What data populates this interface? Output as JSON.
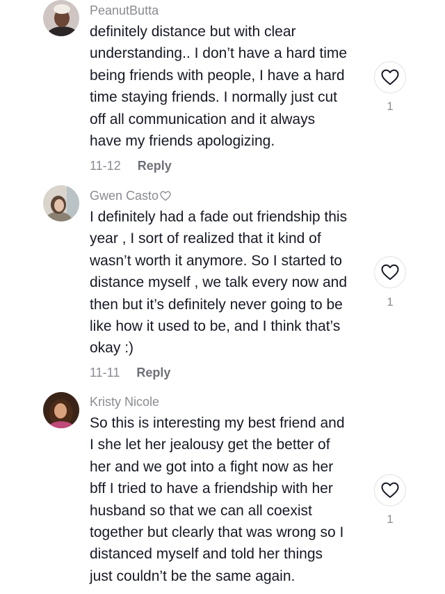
{
  "comments": [
    {
      "username": "PeanutButta",
      "has_heart_badge": false,
      "lines": [
        "definitely distance but with clear",
        "understanding.. I don’t have a hard time",
        "being friends with people, I have a hard",
        "time staying friends. I normally just cut",
        "off all communication and it always",
        "have my friends apologizing."
      ],
      "date": "11-12",
      "reply_label": "Reply",
      "like_count": "1",
      "avatar_colors": {
        "bg": "#cfc6c4",
        "skin": "#6b4636",
        "hair": "#f1ece6",
        "shirt": "#2b2526"
      }
    },
    {
      "username": "Gwen Casto",
      "has_heart_badge": true,
      "lines": [
        "I definitely had a fade out friendship this",
        "year , I sort of realized that it kind of",
        "wasn’t worth it anymore. So I started to",
        "distance myself , we talk every now and",
        "then but it’s definitely never going to be",
        "like how it used to be, and I think that’s",
        "okay :)"
      ],
      "date": "11-11",
      "reply_label": "Reply",
      "like_count": "1",
      "avatar_colors": {
        "bg": "#d9d4cc",
        "skin": "#e2c2ab",
        "hair": "#5b4434",
        "shirt": "#8a8172"
      }
    },
    {
      "username": "Kristy Nicole",
      "has_heart_badge": false,
      "lines": [
        "So this is interesting my best friend and",
        "I she let her jealousy get the better of",
        "her and we got into a fight now as her",
        "bff I tried to have a friendship with her",
        "husband so that we can all coexist",
        "together but clearly that was wrong so I",
        "distanced myself and told her things",
        "just couldn’t be the same again."
      ],
      "date": "",
      "reply_label": "",
      "like_count": "1",
      "avatar_colors": {
        "bg": "#3a2418",
        "skin": "#d9a27f",
        "hair": "#4a2a18",
        "shirt": "#c04a7a"
      }
    }
  ],
  "icons": {
    "like": "heart-outline-icon",
    "badge": "heart-outline-icon"
  },
  "colors": {
    "text": "#161823",
    "meta": "#8a8b91",
    "reply": "#6f7077"
  }
}
